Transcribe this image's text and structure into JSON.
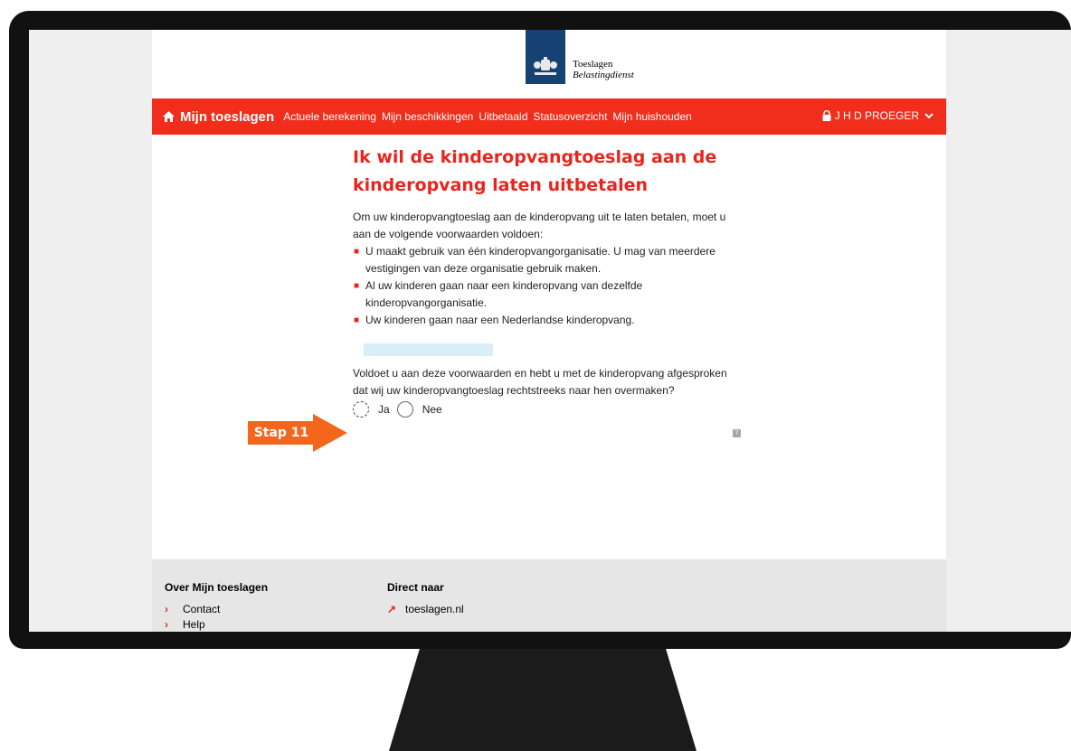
{
  "header": {
    "brand_line1": "Toeslagen",
    "brand_line2": "Belastingdienst"
  },
  "nav": {
    "home_label": "Mijn toeslagen",
    "links": [
      "Actuele berekening",
      "Mijn beschikkingen",
      "Uitbetaald",
      "Statusoverzicht",
      "Mijn huishouden"
    ],
    "user_label": "J H D PROEGER",
    "color": "#f12d1b"
  },
  "main": {
    "title": "Ik wil de kinderopvangtoeslag aan de kinderopvang laten uitbetalen",
    "intro": "Om uw kinderopvangtoeslag aan de kinderopvang uit te laten betalen, moet u aan de volgende voorwaarden voldoen:",
    "conditions": [
      "U maakt gebruik van één kinderopvangorganisatie. U mag van meerdere vestigingen van deze organisatie gebruik maken.",
      "Al uw kinderen gaan naar een kinderopvang van dezelfde kinderopvangorganisatie.",
      "Uw kinderen gaan naar een Nederlandse kinderopvang."
    ],
    "question": "Voldoet u aan deze voorwaarden en hebt u met de kinderopvang afgesproken dat wij uw kinderopvangtoeslag rechtstreeks naar hen overmaken?",
    "options": [
      "Ja",
      "Nee"
    ],
    "selected": "none"
  },
  "annotation": {
    "step_label": "Stap 11",
    "color": "#f4661b"
  },
  "footer": {
    "col1_title": "Over Mijn toeslagen",
    "col1_links": [
      "Contact",
      "Help"
    ],
    "col2_title": "Direct naar",
    "col2_links": [
      "toeslagen.nl"
    ]
  }
}
